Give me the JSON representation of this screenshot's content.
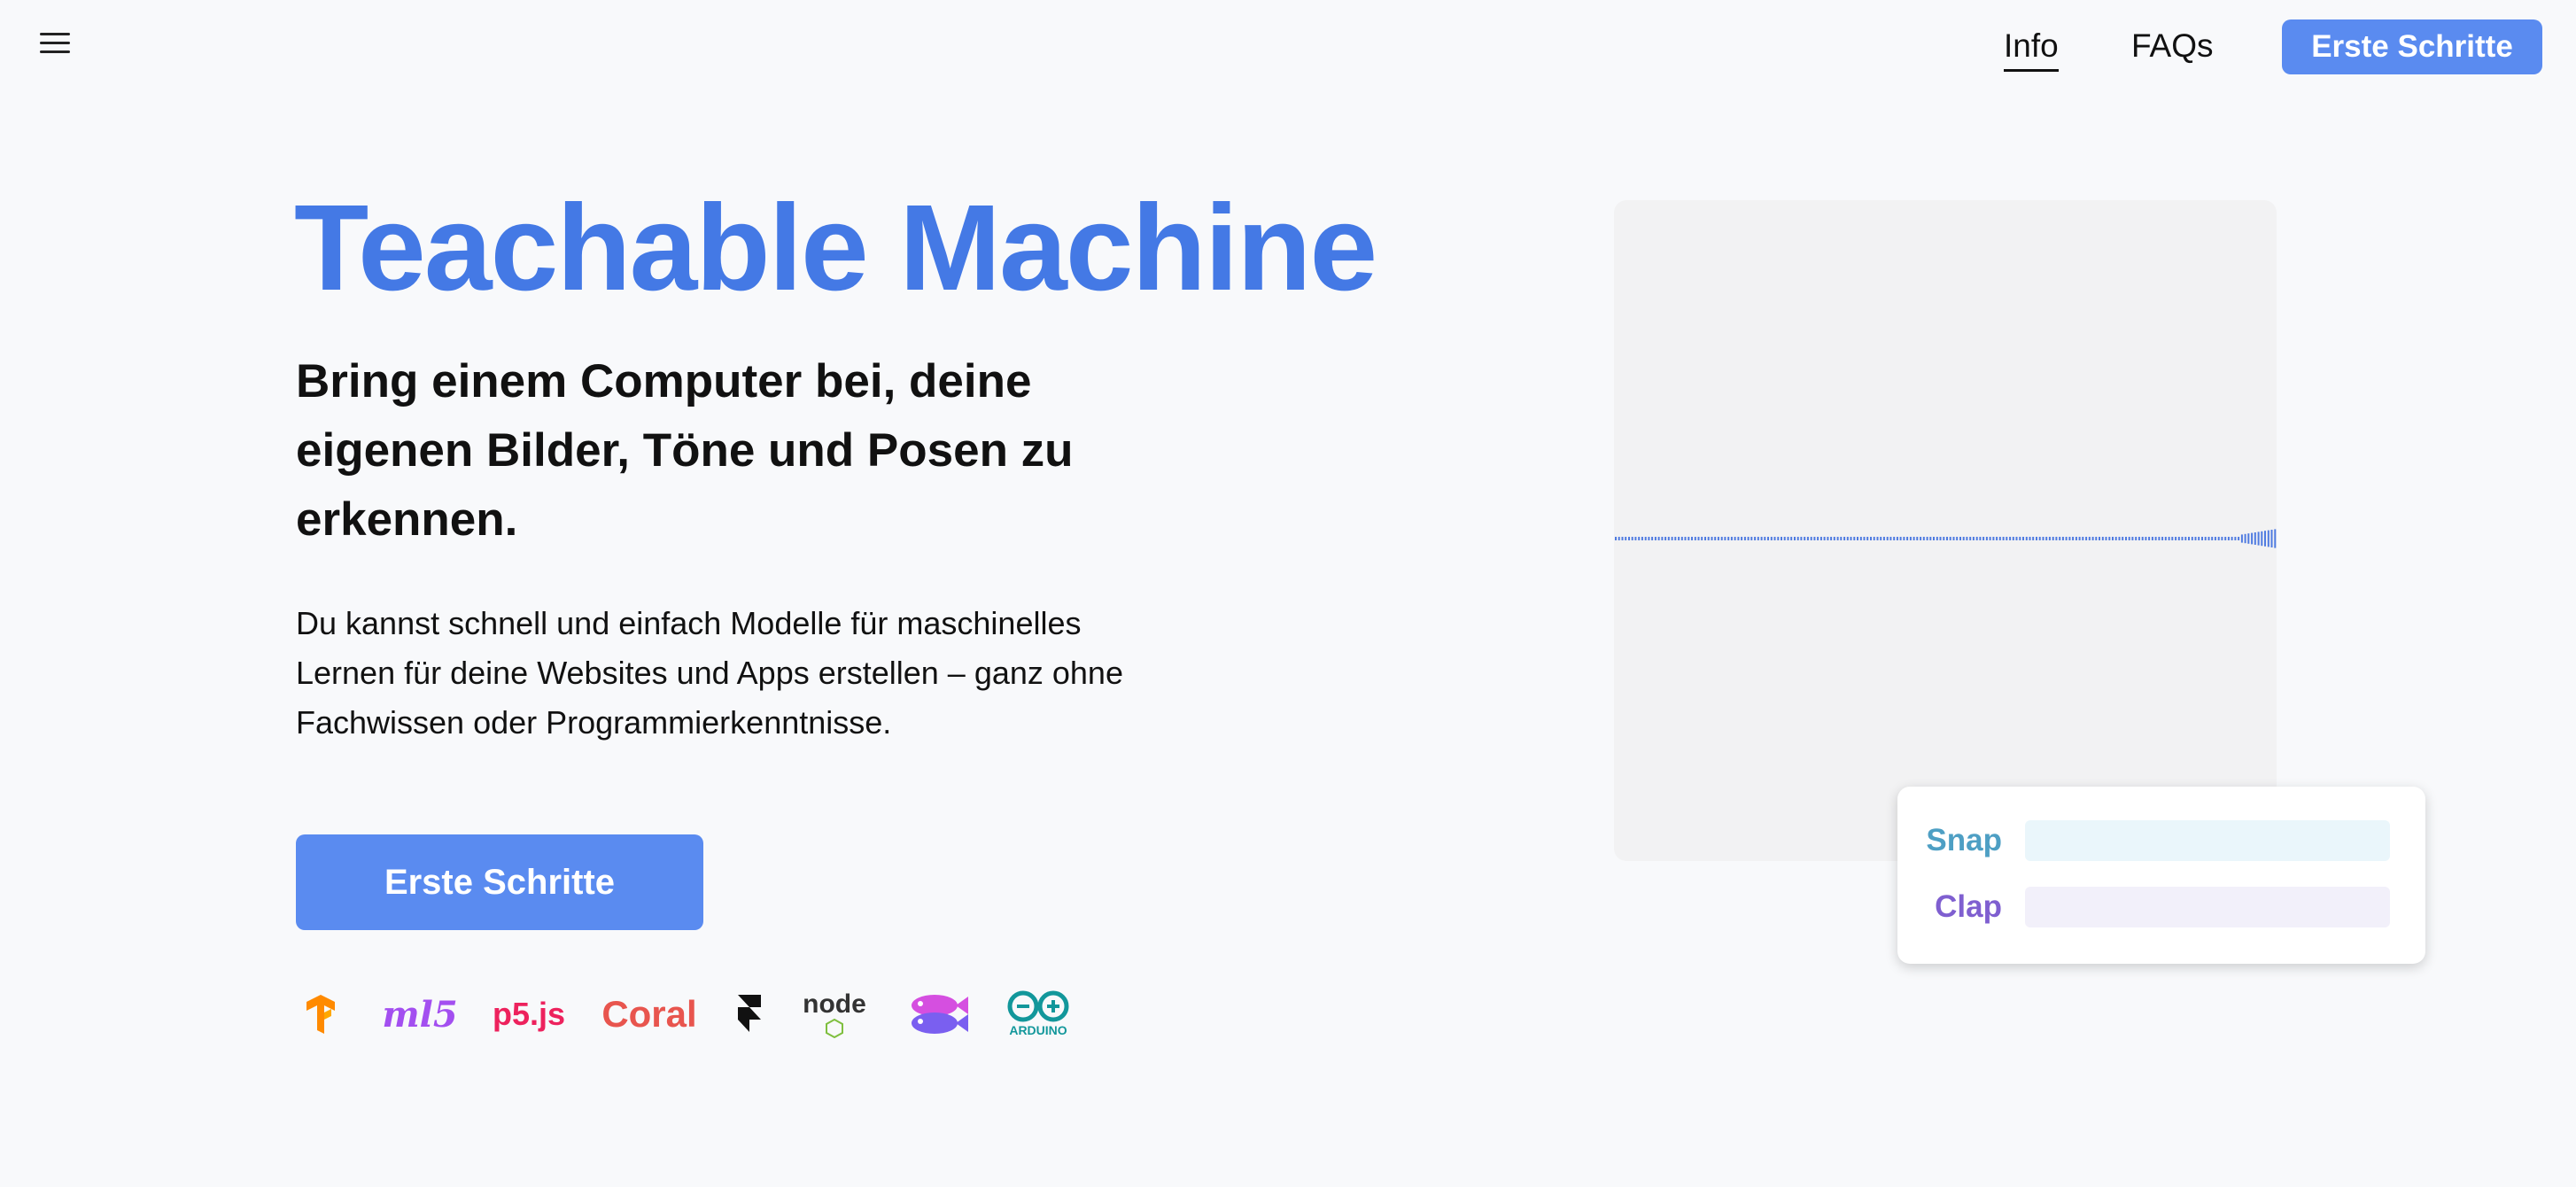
{
  "nav": {
    "info": "Info",
    "faqs": "FAQs",
    "cta": "Erste Schritte"
  },
  "hero": {
    "title": "Teachable Machine",
    "subtitle": "Bring einem Computer bei, deine eigenen Bilder, Töne und Posen zu erkennen.",
    "description": "Du kannst schnell und einfach Modelle für maschinelles Lernen für deine Websites und Apps erstellen – ganz ohne Fachwissen oder Programmierkenntnisse.",
    "cta": "Erste Schritte"
  },
  "logos": [
    {
      "id": "tensorflow",
      "icon": "tensorflow-icon",
      "color": "#ff8a00"
    },
    {
      "id": "ml5",
      "text": "ml5",
      "color": "#a34ff0"
    },
    {
      "id": "p5js",
      "text": "p5.js",
      "color": "#ed225d"
    },
    {
      "id": "coral",
      "text": "Coral",
      "color": "#e8554e"
    },
    {
      "id": "framer",
      "icon": "framer-icon",
      "color": "#111111"
    },
    {
      "id": "node",
      "text": "node",
      "color": "#333333"
    },
    {
      "id": "glitch",
      "icon": "glitch-fish-icon",
      "color": "#d54fe0"
    },
    {
      "id": "arduino",
      "text": "ARDUINO",
      "color": "#12979b"
    }
  ],
  "demo": {
    "classes": [
      {
        "label": "Snap",
        "color": "#4e9fc4",
        "bar_color": "#eaf6fb",
        "level": 0
      },
      {
        "label": "Clap",
        "color": "#7f5fd0",
        "bar_color": "#f2f0fa",
        "level": 0
      }
    ],
    "waveform_color": "#4f7be0"
  }
}
